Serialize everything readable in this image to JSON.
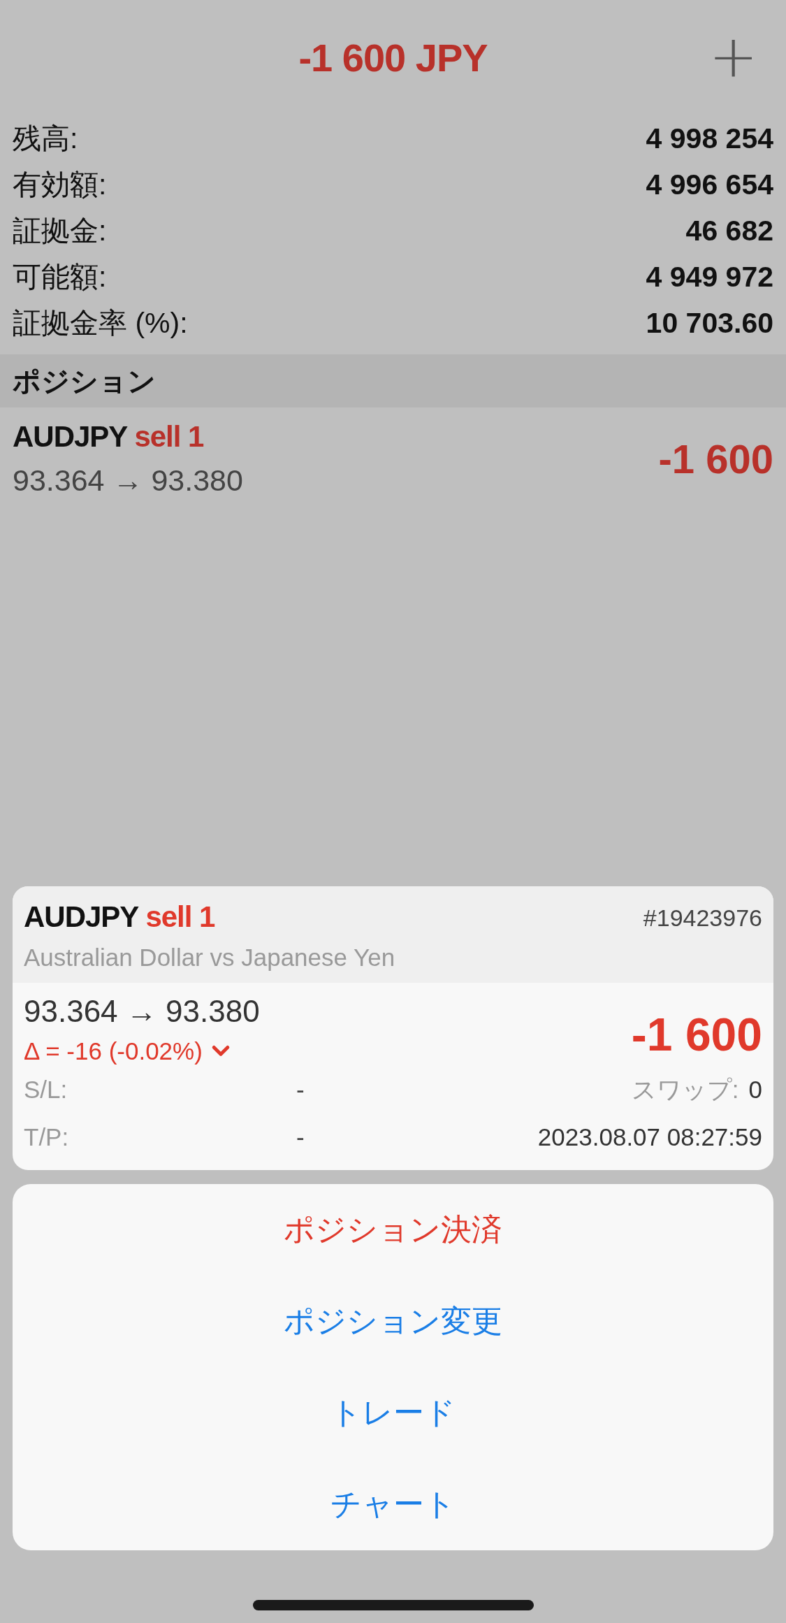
{
  "header": {
    "title": "-1 600 JPY",
    "add_button": "+"
  },
  "summary": [
    {
      "label": "残高:",
      "value": "4 998 254"
    },
    {
      "label": "有効額:",
      "value": "4 996 654"
    },
    {
      "label": "証拠金:",
      "value": "46 682"
    },
    {
      "label": "可能額:",
      "value": "4 949 972"
    },
    {
      "label": "証拠金率 (%):",
      "value": "10 703.60"
    }
  ],
  "section_title": "ポジション",
  "positions": [
    {
      "symbol": "AUDJPY",
      "side": "sell 1",
      "prices": "93.364 → 93.380",
      "profit": "-1 600"
    }
  ],
  "detail_card": {
    "symbol": "AUDJPY",
    "side": "sell 1",
    "ticket": "#19423976",
    "description": "Australian Dollar vs Japanese Yen",
    "prices": "93.364 → 93.380",
    "change": "Δ = -16 (-0.02%)",
    "profit": "-1 600",
    "fields": [
      {
        "label": "S/L:",
        "value": "-",
        "extra_label": "スワップ:",
        "extra_value": "0"
      },
      {
        "label": "T/P:",
        "value": "-",
        "extra_value": "2023.08.07 08:27:59"
      }
    ]
  },
  "actions": [
    {
      "label": "ポジション決済",
      "kind": "destructive"
    },
    {
      "label": "ポジション変更",
      "kind": "default"
    },
    {
      "label": "トレード",
      "kind": "default"
    },
    {
      "label": "チャート",
      "kind": "default"
    }
  ]
}
